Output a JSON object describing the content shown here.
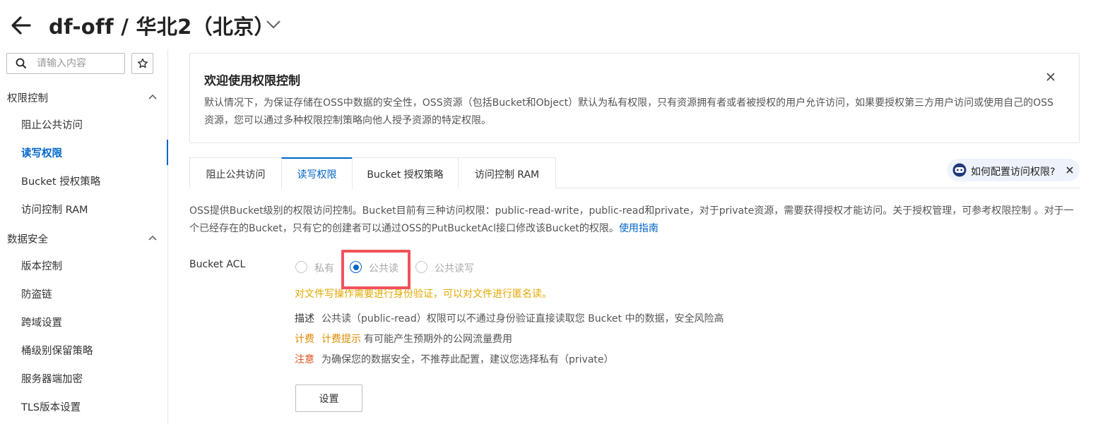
{
  "header": {
    "title": "df-off / 华北2（北京）",
    "back_icon": "arrow-left-icon",
    "dropdown_icon": "chevron-down-icon"
  },
  "sidebar": {
    "search_placeholder": "请输入内容",
    "groups": [
      {
        "label": "权限控制",
        "expanded": true,
        "items": [
          {
            "label": "阻止公共访问",
            "active": false
          },
          {
            "label": "读写权限",
            "active": true
          },
          {
            "label": "Bucket 授权策略",
            "active": false
          },
          {
            "label": "访问控制 RAM",
            "active": false
          }
        ]
      },
      {
        "label": "数据安全",
        "expanded": true,
        "items": [
          {
            "label": "版本控制",
            "active": false
          },
          {
            "label": "防盗链",
            "active": false
          },
          {
            "label": "跨域设置",
            "active": false
          },
          {
            "label": "桶级别保留策略",
            "active": false
          },
          {
            "label": "服务器端加密",
            "active": false
          },
          {
            "label": "TLS版本设置",
            "active": false
          }
        ]
      }
    ]
  },
  "welcome": {
    "title": "欢迎使用权限控制",
    "text": "默认情况下，为保证存储在OSS中数据的安全性，OSS资源（包括Bucket和Object）默认为私有权限，只有资源拥有者或者被授权的用户允许访问，如果要授权第三方用户访问或使用自己的OSS资源，您可以通过多种权限控制策略向他人授予资源的特定权限。"
  },
  "tabs": [
    {
      "label": "阻止公共访问",
      "active": false
    },
    {
      "label": "读写权限",
      "active": true
    },
    {
      "label": "Bucket 授权策略",
      "active": false
    },
    {
      "label": "访问控制 RAM",
      "active": false
    }
  ],
  "help_chip": {
    "label": "如何配置访问权限?"
  },
  "description": {
    "text": "OSS提供Bucket级别的权限访问控制。Bucket目前有三种访问权限：public-read-write，public-read和private，对于private资源，需要获得授权才能访问。关于授权管理，可参考权限控制 。对于一个已经存在的Bucket，只有它的创建者可以通过OSS的PutBucketAcl接口修改该Bucket的权限。",
    "link": "使用指南"
  },
  "acl": {
    "label": "Bucket ACL",
    "options": [
      {
        "label": "私有",
        "checked": false
      },
      {
        "label": "公共读",
        "checked": true
      },
      {
        "label": "公共读写",
        "checked": false
      }
    ],
    "warning": "对文件写操作需要进行身份验证，可以对文件进行匿名读。",
    "desc_key": "描述",
    "desc_value": "公共读（public-read）权限可以不通过身份验证直接读取您 Bucket 中的数据，安全风险高",
    "billing_key": "计费",
    "billing_tip": "计费提示",
    "billing_value": "有可能产生预期外的公网流量费用",
    "note_key": "注意",
    "note_value": "为确保您的数据安全，不推荐此配置，建议您选择私有（private）",
    "set_button": "设置"
  },
  "colors": {
    "accent": "#0064c8",
    "warning": "#e0a800",
    "highlight": "#f0525a"
  }
}
